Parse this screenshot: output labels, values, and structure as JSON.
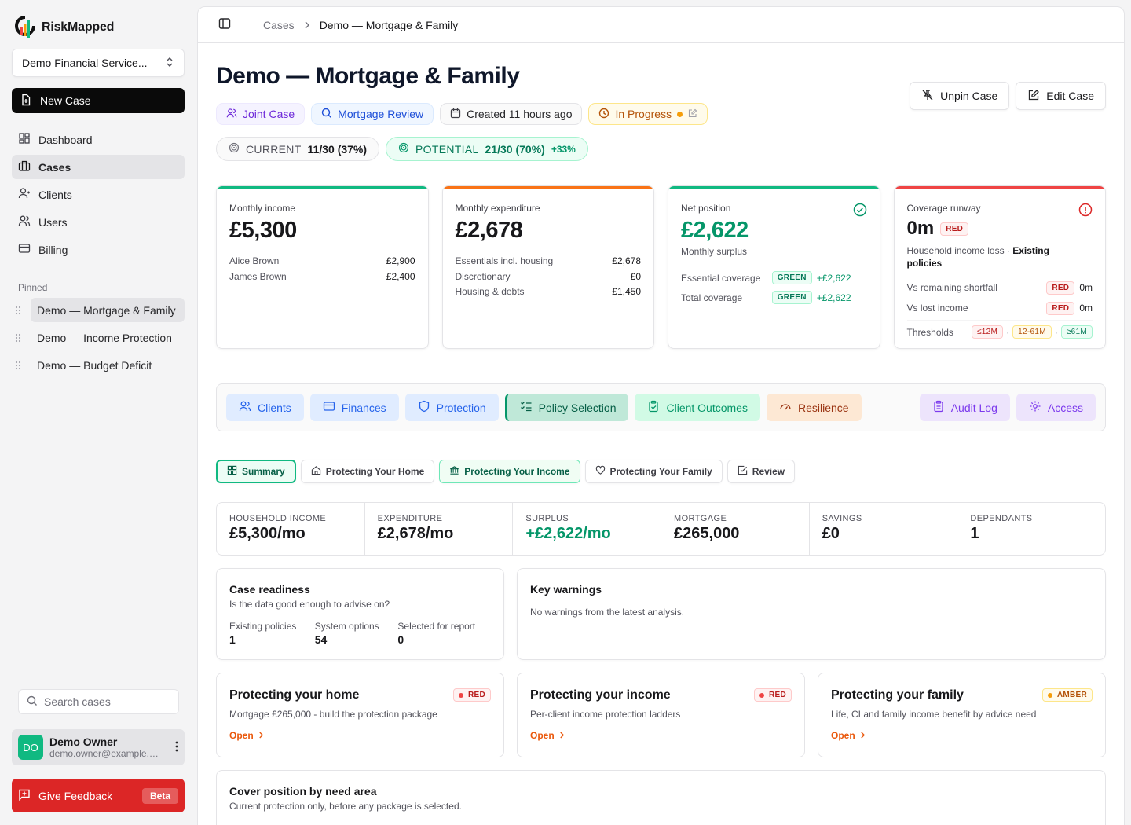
{
  "brand": {
    "name": "RiskMapped"
  },
  "sidebar": {
    "org": "Demo Financial Service...",
    "new_case": "New Case",
    "nav": [
      {
        "label": "Dashboard",
        "icon": "dashboard-icon"
      },
      {
        "label": "Cases",
        "icon": "briefcase-icon"
      },
      {
        "label": "Clients",
        "icon": "user-icon"
      },
      {
        "label": "Users",
        "icon": "users-icon"
      },
      {
        "label": "Billing",
        "icon": "card-icon"
      }
    ],
    "pinned_title": "Pinned",
    "pinned": [
      "Demo — Mortgage & Family",
      "Demo — Income Protection",
      "Demo — Budget Deficit"
    ],
    "search_placeholder": "Search cases",
    "user": {
      "initials": "DO",
      "name": "Demo Owner",
      "email": "demo.owner@example.com"
    },
    "feedback": {
      "label": "Give Feedback",
      "badge": "Beta"
    }
  },
  "breadcrumb": {
    "parent": "Cases",
    "current": "Demo — Mortgage & Family"
  },
  "page": {
    "title": "Demo — Mortgage & Family",
    "unpin": "Unpin Case",
    "edit": "Edit Case",
    "tags": {
      "joint": "Joint Case",
      "review": "Mortgage Review",
      "created": "Created 11 hours ago",
      "status": "In Progress"
    },
    "score": {
      "current_label": "CURRENT",
      "current_value": "11/30 (37%)",
      "potential_label": "POTENTIAL",
      "potential_value": "21/30 (70%)",
      "potential_delta": "+33%"
    }
  },
  "kpis": {
    "income": {
      "label": "Monthly income",
      "value": "£5,300",
      "rows": [
        {
          "k": "Alice Brown",
          "v": "£2,900"
        },
        {
          "k": "James Brown",
          "v": "£2,400"
        }
      ]
    },
    "expenditure": {
      "label": "Monthly expenditure",
      "value": "£2,678",
      "rows": [
        {
          "k": "Essentials incl. housing",
          "v": "£2,678"
        },
        {
          "k": "Discretionary",
          "v": "£0"
        },
        {
          "k": "Housing & debts",
          "v": "£1,450"
        }
      ]
    },
    "net": {
      "label": "Net position",
      "value": "£2,622",
      "sub": "Monthly surplus",
      "rows": [
        {
          "k": "Essential coverage",
          "badge": "GREEN",
          "v": "+£2,622"
        },
        {
          "k": "Total coverage",
          "badge": "GREEN",
          "v": "+£2,622"
        }
      ]
    },
    "runway": {
      "label": "Coverage runway",
      "value": "0m",
      "badge": "RED",
      "desc_a": "Household income loss · ",
      "desc_b": "Existing policies",
      "rows": [
        {
          "k": "Vs remaining shortfall",
          "badge": "RED",
          "v": "0m"
        },
        {
          "k": "Vs lost income",
          "badge": "RED",
          "v": "0m"
        }
      ],
      "thresholds_label": "Thresholds",
      "thresholds": [
        "≤12M",
        "12-61M",
        "≥61M"
      ],
      "sep": "·"
    }
  },
  "tabs": [
    {
      "label": "Clients",
      "icon": "users-icon"
    },
    {
      "label": "Finances",
      "icon": "card-icon"
    },
    {
      "label": "Protection",
      "icon": "shield-icon"
    },
    {
      "label": "Policy Selection",
      "icon": "checklist-icon"
    },
    {
      "label": "Client Outcomes",
      "icon": "clipboard-check-icon"
    },
    {
      "label": "Resilience",
      "icon": "gauge-icon"
    },
    {
      "label": "Audit Log",
      "icon": "clipboard-icon"
    },
    {
      "label": "Access",
      "icon": "gear-icon"
    }
  ],
  "subtabs": [
    "Summary",
    "Protecting Your Home",
    "Protecting Your Income",
    "Protecting Your Family",
    "Review"
  ],
  "stats": [
    {
      "label": "Household income",
      "value": "£5,300/mo"
    },
    {
      "label": "Expenditure",
      "value": "£2,678/mo"
    },
    {
      "label": "Surplus",
      "value": "+£2,622/mo"
    },
    {
      "label": "Mortgage",
      "value": "£265,000"
    },
    {
      "label": "Savings",
      "value": "£0"
    },
    {
      "label": "Dependants",
      "value": "1"
    }
  ],
  "readiness": {
    "title": "Case readiness",
    "sub": "Is the data good enough to advise on?",
    "items": [
      {
        "k": "Existing policies",
        "v": "1"
      },
      {
        "k": "System options",
        "v": "54"
      },
      {
        "k": "Selected for report",
        "v": "0"
      }
    ]
  },
  "warnings": {
    "title": "Key warnings",
    "text": "No warnings from the latest analysis."
  },
  "cards": [
    {
      "title": "Protecting your home",
      "badge": "RED",
      "desc": "Mortgage £265,000 - build the protection package",
      "open": "Open"
    },
    {
      "title": "Protecting your income",
      "badge": "RED",
      "desc": "Per-client income protection ladders",
      "open": "Open"
    },
    {
      "title": "Protecting your family",
      "badge": "AMBER",
      "desc": "Life, CI and family income benefit by advice need",
      "open": "Open"
    }
  ],
  "cover": {
    "title": "Cover position by need area",
    "sub": "Current protection only, before any package is selected."
  },
  "colors": {
    "green": "#10b981",
    "orange": "#f97316",
    "red": "#ef4444",
    "accent": "#059669"
  }
}
